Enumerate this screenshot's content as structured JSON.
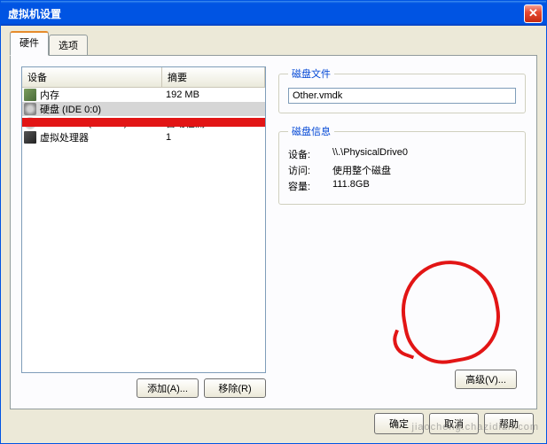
{
  "window": {
    "title": "虚拟机设置"
  },
  "tabs": {
    "hardware": "硬件",
    "options": "选项"
  },
  "table": {
    "headers": {
      "device": "设备",
      "summary": "摘要"
    },
    "rows": [
      {
        "device": "内存",
        "summary": "192 MB",
        "icon": "mem"
      },
      {
        "device": "硬盘 (IDE 0:0)",
        "summary": "",
        "icon": "disk",
        "selected": true
      },
      {
        "device": "CD-ROM1 (IDE 1:0)",
        "summary": "自动检测",
        "icon": "cd"
      },
      {
        "device": "虚拟处理器",
        "summary": "1",
        "icon": "cpu"
      }
    ]
  },
  "buttons": {
    "add": "添加(A)...",
    "remove": "移除(R)",
    "advanced": "高级(V)...",
    "ok": "确定",
    "cancel": "取消",
    "help": "帮助"
  },
  "diskfile": {
    "legend": "磁盘文件",
    "value": "Other.vmdk"
  },
  "diskinfo": {
    "legend": "磁盘信息",
    "device_label": "设备:",
    "device_value": "\\\\.\\PhysicalDrive0",
    "access_label": "访问:",
    "access_value": "使用整个磁盘",
    "capacity_label": "容量:",
    "capacity_value": "111.8GB"
  },
  "watermark": "jiaocheng.chazidian.com"
}
